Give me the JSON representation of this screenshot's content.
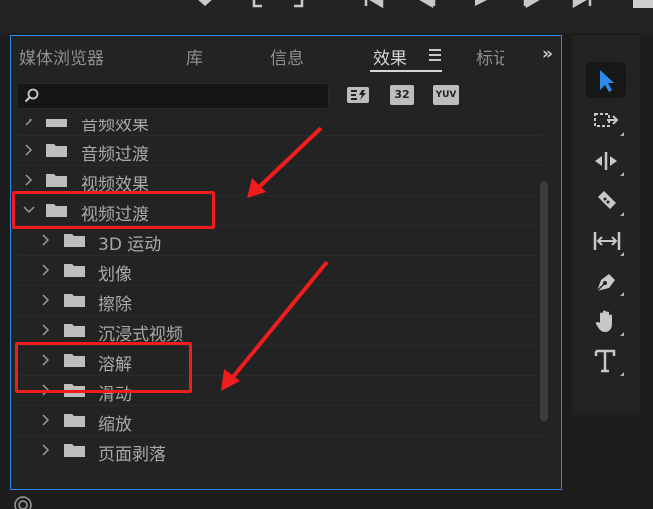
{
  "window": {
    "tabs": [
      {
        "label": "媒体浏览器",
        "active": false
      },
      {
        "label": "库",
        "active": false
      },
      {
        "label": "信息",
        "active": false
      },
      {
        "label": "效果",
        "active": true
      },
      {
        "label": "标记",
        "active": false
      }
    ],
    "overflow_label": "»"
  },
  "search": {
    "placeholder": "",
    "value": ""
  },
  "filter_buttons": [
    {
      "label": "",
      "icon": "accelerated-effects-icon"
    },
    {
      "label": "32",
      "icon": "32bit-color-icon"
    },
    {
      "label": "YUV",
      "icon": "yuv-effects-icon"
    }
  ],
  "tree": {
    "items": [
      {
        "label": "音频效果",
        "level": 0,
        "expanded": false
      },
      {
        "label": "音频过渡",
        "level": 0,
        "expanded": false
      },
      {
        "label": "视频效果",
        "level": 0,
        "expanded": false
      },
      {
        "label": "视频过渡",
        "level": 0,
        "expanded": true
      },
      {
        "label": "3D 运动",
        "level": 1,
        "expanded": false
      },
      {
        "label": "划像",
        "level": 1,
        "expanded": false
      },
      {
        "label": "擦除",
        "level": 1,
        "expanded": false
      },
      {
        "label": "沉浸式视频",
        "level": 1,
        "expanded": false
      },
      {
        "label": "溶解",
        "level": 1,
        "expanded": false
      },
      {
        "label": "滑动",
        "level": 1,
        "expanded": false
      },
      {
        "label": "缩放",
        "level": 1,
        "expanded": false
      },
      {
        "label": "页面剥落",
        "level": 1,
        "expanded": false
      }
    ]
  },
  "toolbox": {
    "tools": [
      {
        "name": "selection-tool",
        "icon": "arrow-cursor-icon",
        "selected": true
      },
      {
        "name": "track-select-tool",
        "icon": "track-select-icon",
        "selected": false
      },
      {
        "name": "ripple-edit-tool",
        "icon": "ripple-edit-icon",
        "selected": false
      },
      {
        "name": "razor-tool",
        "icon": "razor-icon",
        "selected": false
      },
      {
        "name": "slip-tool",
        "icon": "slip-icon",
        "selected": false
      },
      {
        "name": "pen-tool",
        "icon": "pen-icon",
        "selected": false
      },
      {
        "name": "hand-tool",
        "icon": "hand-icon",
        "selected": false
      },
      {
        "name": "type-tool",
        "icon": "type-icon",
        "selected": false
      }
    ]
  },
  "annotations": {
    "color": "#ef1d1d",
    "highlighted_items": [
      "视频过渡",
      "溶解"
    ]
  },
  "colors": {
    "accent": "#2d8ceb",
    "panel_bg": "#232323",
    "selection_tool": "#2d8ceb"
  }
}
